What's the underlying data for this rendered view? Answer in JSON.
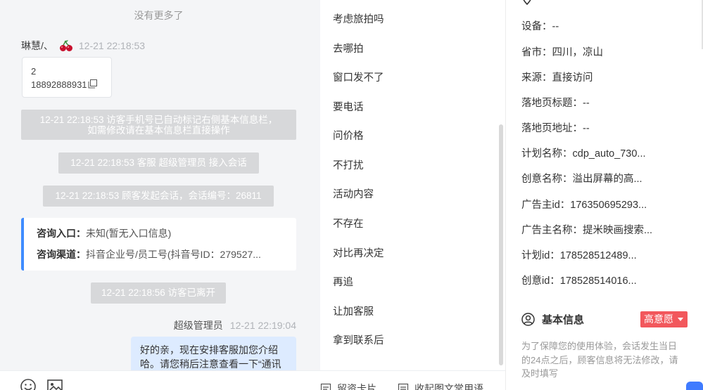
{
  "chat": {
    "no_more": "没有更多了",
    "visitor_name": "琳慧/、",
    "visitor_time": "12-21 22:18:53",
    "phone_card": {
      "line1": "2",
      "line2": "18892888931"
    },
    "system_messages": [
      "12-21 22:18:53 访客手机号已自动标记右侧基本信息栏，",
      "如需修改请在基本信息栏直接操作",
      "12-21 22:18:53 客服 超级管理员 接入会话",
      "12-21 22:18:53 顾客发起会话，会话编号：26811",
      "12-21 22:18:56 访客已离开"
    ],
    "entry_card": {
      "entry_label": "咨询入口：",
      "entry_value": "未知(暂无入口信息)",
      "channel_label": "咨询渠道：",
      "channel_value": "抖音企业号/员工号(抖音号ID：279527..."
    },
    "agent_name": "超级管理员",
    "agent_time": "12-21 22:19:04",
    "agent_message_line1": "好的亲，现在安排客服加您介绍",
    "agent_message_line2": "哈。请您稍后注意查看一下“通讯"
  },
  "quick_replies": [
    "考虑旅拍吗",
    "去哪拍",
    "窗口发不了",
    "要电话",
    "问价格",
    "不打扰",
    "活动内容",
    "不存在",
    "对比再决定",
    "再追",
    "让加客服",
    "拿到联系后"
  ],
  "quick_tools": {
    "message_card": "留资卡片",
    "collapse_phrases": "收起图文常用语"
  },
  "info": {
    "fields": [
      "设备：--",
      "省市：四川，凉山",
      "来源：直接访问",
      "落地页标题：--",
      "落地页地址：--",
      "计划名称：cdp_auto_730...",
      "创意名称：溢出屏幕的高...",
      "广告主id：176350695293...",
      "广告主名称：提米映画搜索...",
      "计划id：178528512489...",
      "创意id：178528514016..."
    ],
    "basic_info_title": "基本信息",
    "intent_tag": "高意愿",
    "notice": "为了保障您的使用体验，会话发生当日的24点之后，顾客信息将无法修改，请及时填写"
  },
  "colors": {
    "accent_blue": "#3f8cff",
    "intent_red": "#f2575c",
    "system_gray": "#d7d8da",
    "bubble_blue": "#ddebff"
  },
  "icons": [
    "cherry-icon",
    "copy-icon",
    "emoji-icon",
    "image-icon",
    "card-icon",
    "phrase-icon",
    "location-icon",
    "user-circle-icon",
    "caret-down-icon"
  ]
}
